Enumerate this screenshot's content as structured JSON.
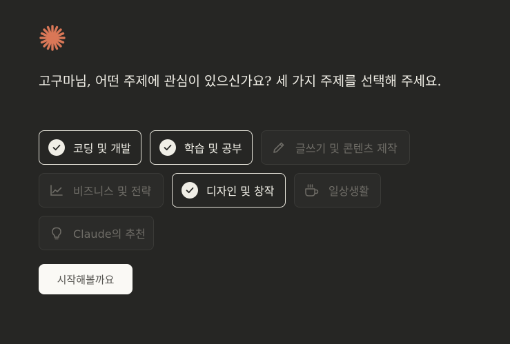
{
  "question": "고구마님, 어떤 주제에 관심이 있으신가요? 세 가지 주제를 선택해 주세요.",
  "colors": {
    "background": "#262624",
    "accent": "#d97757",
    "selected_border": "#e8e6dc",
    "unselected_text": "#6f6d67",
    "button_bg": "#faf9f5"
  },
  "topics": [
    {
      "label": "코딩 및 개발",
      "selected": true,
      "icon": "check-icon"
    },
    {
      "label": "학습 및 공부",
      "selected": true,
      "icon": "check-icon"
    },
    {
      "label": "글쓰기 및 콘텐츠 제작",
      "selected": false,
      "icon": "pencil-icon"
    },
    {
      "label": "비즈니스 및 전략",
      "selected": false,
      "icon": "line-chart-icon"
    },
    {
      "label": "디자인 및 창작",
      "selected": true,
      "icon": "check-icon"
    },
    {
      "label": "일상생활",
      "selected": false,
      "icon": "coffee-cup-icon"
    },
    {
      "label": "Claude의 추천",
      "selected": false,
      "icon": "lightbulb-icon"
    }
  ],
  "start_button": {
    "label": "시작해볼까요"
  }
}
